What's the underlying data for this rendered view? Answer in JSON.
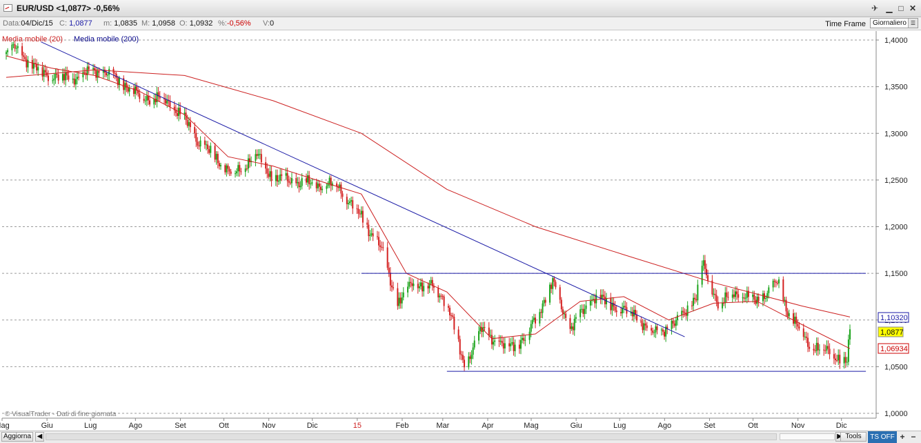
{
  "window": {
    "title": "EUR/USD <1,0877> -0,56%",
    "buttons": [
      "pin",
      "minimize",
      "maximize",
      "close"
    ]
  },
  "info_bar": {
    "date_label": "Data:",
    "date_value": "04/Dic/15",
    "close_label": "C:",
    "close_value": "1,0877",
    "min_label": "m:",
    "min_value": "1,0835",
    "max_label": "M:",
    "max_value": "1,0958",
    "open_label": "O:",
    "open_value": "1,0932",
    "pct_label": "%:",
    "pct_value": "-0,56%",
    "vol_label": "V:",
    "vol_value": "0",
    "timeframe_label": "Time Frame",
    "timeframe_value": "Giornaliero"
  },
  "legend": {
    "ma20": "Media mobile (20)",
    "ma200": "Media mobile (200)"
  },
  "watermark": "© VisualTrader - Dati di fine giornata",
  "price_tags": {
    "ma200_value": "1,10320",
    "last_value": "1,0877",
    "ma20_value": "1,06934"
  },
  "colors": {
    "up_candle": "#1aa31a",
    "down_candle": "#d42020",
    "ma20": "#cc1f1f",
    "ma200": "#0a0a8c",
    "trendline": "#1a1aa6",
    "year_label": "#cc1f1f"
  },
  "bottom_bar": {
    "refresh_label": "Aggiorna",
    "tools_label": "Tools",
    "ts_label": "TS OFF"
  },
  "chart_data": {
    "type": "candlestick",
    "title": "EUR/USD <1,0877> -0,56%",
    "ylim": [
      1.0,
      1.41
    ],
    "y_ticks": [
      "1,4000",
      "1,3500",
      "1,3000",
      "1,2500",
      "1,2000",
      "1,1500",
      "1,1000",
      "1,0500",
      "1,0000"
    ],
    "y_tick_values": [
      1.4,
      1.35,
      1.3,
      1.25,
      1.2,
      1.15,
      1.1,
      1.05,
      1.0
    ],
    "x_labels": [
      "Mag",
      "Giu",
      "Lug",
      "Ago",
      "Set",
      "Ott",
      "Nov",
      "Dic",
      "15",
      "Feb",
      "Mar",
      "Apr",
      "Mag",
      "Giu",
      "Lug",
      "Ago",
      "Set",
      "Ott",
      "Nov",
      "Dic"
    ],
    "x_label_dates": [
      "2014-05-01",
      "2014-06-01",
      "2014-07-01",
      "2014-08-01",
      "2014-09-01",
      "2014-10-01",
      "2014-11-01",
      "2014-12-01",
      "2015-01-01",
      "2015-02-01",
      "2015-03-01",
      "2015-04-01",
      "2015-05-01",
      "2015-06-01",
      "2015-07-01",
      "2015-08-01",
      "2015-09-01",
      "2015-10-01",
      "2015-11-01",
      "2015-12-01"
    ],
    "x_range": [
      "2014-05-01",
      "2015-12-04"
    ],
    "price_path": [
      [
        "2014-05-01",
        1.385
      ],
      [
        "2014-05-08",
        1.392
      ],
      [
        "2014-05-20",
        1.37
      ],
      [
        "2014-06-05",
        1.36
      ],
      [
        "2014-06-20",
        1.36
      ],
      [
        "2014-07-01",
        1.368
      ],
      [
        "2014-07-15",
        1.36
      ],
      [
        "2014-08-01",
        1.34
      ],
      [
        "2014-08-20",
        1.335
      ],
      [
        "2014-09-01",
        1.315
      ],
      [
        "2014-09-10",
        1.292
      ],
      [
        "2014-09-25",
        1.27
      ],
      [
        "2014-10-05",
        1.255
      ],
      [
        "2014-10-20",
        1.278
      ],
      [
        "2014-11-01",
        1.252
      ],
      [
        "2014-11-15",
        1.248
      ],
      [
        "2014-12-01",
        1.245
      ],
      [
        "2014-12-15",
        1.245
      ],
      [
        "2015-01-01",
        1.21
      ],
      [
        "2015-01-15",
        1.175
      ],
      [
        "2015-01-26",
        1.117
      ],
      [
        "2015-02-05",
        1.14
      ],
      [
        "2015-02-20",
        1.135
      ],
      [
        "2015-03-01",
        1.12
      ],
      [
        "2015-03-13",
        1.05
      ],
      [
        "2015-03-25",
        1.09
      ],
      [
        "2015-04-10",
        1.07
      ],
      [
        "2015-04-24",
        1.08
      ],
      [
        "2015-05-13",
        1.14
      ],
      [
        "2015-05-25",
        1.09
      ],
      [
        "2015-06-10",
        1.125
      ],
      [
        "2015-06-25",
        1.115
      ],
      [
        "2015-07-10",
        1.105
      ],
      [
        "2015-07-20",
        1.085
      ],
      [
        "2015-08-05",
        1.095
      ],
      [
        "2015-08-20",
        1.125
      ],
      [
        "2015-08-24",
        1.16
      ],
      [
        "2015-09-05",
        1.115
      ],
      [
        "2015-09-15",
        1.13
      ],
      [
        "2015-10-01",
        1.12
      ],
      [
        "2015-10-15",
        1.14
      ],
      [
        "2015-10-22",
        1.11
      ],
      [
        "2015-11-05",
        1.075
      ],
      [
        "2015-11-20",
        1.065
      ],
      [
        "2015-12-02",
        1.055
      ],
      [
        "2015-12-04",
        1.0877
      ]
    ],
    "ma20_path": [
      [
        "2014-05-01",
        1.383
      ],
      [
        "2014-06-01",
        1.37
      ],
      [
        "2014-07-01",
        1.362
      ],
      [
        "2014-08-01",
        1.345
      ],
      [
        "2014-09-01",
        1.32
      ],
      [
        "2014-10-01",
        1.275
      ],
      [
        "2014-11-01",
        1.265
      ],
      [
        "2014-12-01",
        1.25
      ],
      [
        "2015-01-01",
        1.235
      ],
      [
        "2015-02-01",
        1.15
      ],
      [
        "2015-03-01",
        1.13
      ],
      [
        "2015-04-01",
        1.08
      ],
      [
        "2015-05-01",
        1.085
      ],
      [
        "2015-06-01",
        1.12
      ],
      [
        "2015-07-01",
        1.125
      ],
      [
        "2015-08-01",
        1.1
      ],
      [
        "2015-09-01",
        1.118
      ],
      [
        "2015-10-01",
        1.12
      ],
      [
        "2015-11-01",
        1.095
      ],
      [
        "2015-12-04",
        1.06934
      ]
    ],
    "ma200_path": [
      [
        "2014-05-01",
        1.36
      ],
      [
        "2014-07-01",
        1.368
      ],
      [
        "2014-09-01",
        1.362
      ],
      [
        "2014-11-01",
        1.335
      ],
      [
        "2015-01-01",
        1.3
      ],
      [
        "2015-03-01",
        1.24
      ],
      [
        "2015-05-01",
        1.2
      ],
      [
        "2015-07-01",
        1.17
      ],
      [
        "2015-09-01",
        1.14
      ],
      [
        "2015-11-01",
        1.115
      ],
      [
        "2015-12-04",
        1.1032
      ]
    ],
    "trendlines": [
      {
        "from": [
          "2014-05-25",
          1.398
        ],
        "to": [
          "2015-08-12",
          1.082
        ]
      },
      {
        "from": [
          "2015-01-01",
          1.15
        ],
        "to": [
          "2015-12-15",
          1.15
        ]
      },
      {
        "from": [
          "2015-03-01",
          1.045
        ],
        "to": [
          "2015-12-15",
          1.045
        ]
      }
    ],
    "legend_placement": "top-left",
    "grid": "horizontal dashed"
  }
}
